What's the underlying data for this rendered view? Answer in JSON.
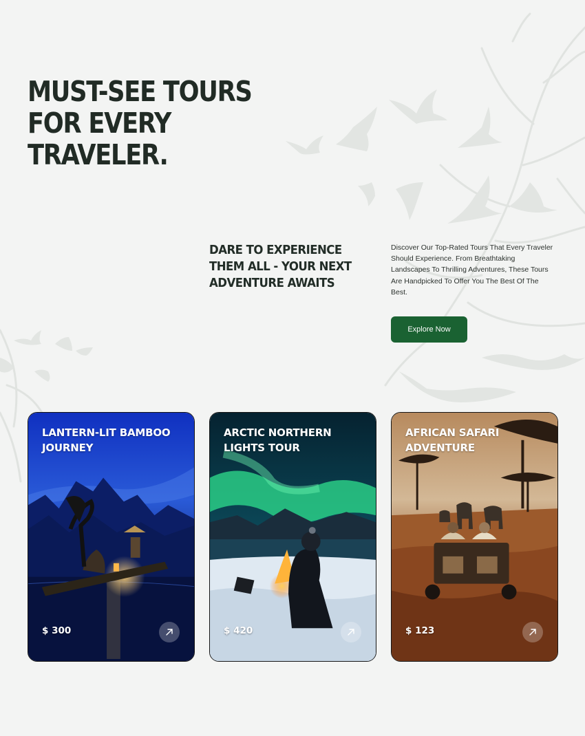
{
  "hero": {
    "title_lines": [
      "MUST-SEE TOURS",
      "FOR EVERY",
      "TRAVELER."
    ]
  },
  "intro": {
    "subheading_lines": [
      "DARE TO EXPERIENCE",
      "THEM ALL - YOUR NEXT",
      "ADVENTURE AWAITS"
    ],
    "description_lines": [
      "Discover Our Top-Rated Tours That Every Traveler",
      "Should Experience. From Breathtaking",
      "Landscapes To Thrilling Adventures, These Tours",
      "Are Handpicked To Offer You The Best Of The",
      "Best."
    ],
    "cta_label": "Explore Now"
  },
  "tours": [
    {
      "title_lines": [
        "LANTERN-LIT BAMBOO",
        "JOURNEY"
      ],
      "price": "$ 300",
      "arrow_icon": "arrow-up-right-icon"
    },
    {
      "title_lines": [
        "ARCTIC NORTHERN",
        "LIGHTS TOUR"
      ],
      "price": "$ 420",
      "arrow_icon": "arrow-up-right-icon"
    },
    {
      "title_lines": [
        "AFRICAN SAFARI",
        "ADVENTURE"
      ],
      "price": "$ 123",
      "arrow_icon": "arrow-up-right-icon"
    }
  ],
  "colors": {
    "background": "#f3f4f3",
    "heading": "#212b25",
    "cta": "#1a6232"
  }
}
